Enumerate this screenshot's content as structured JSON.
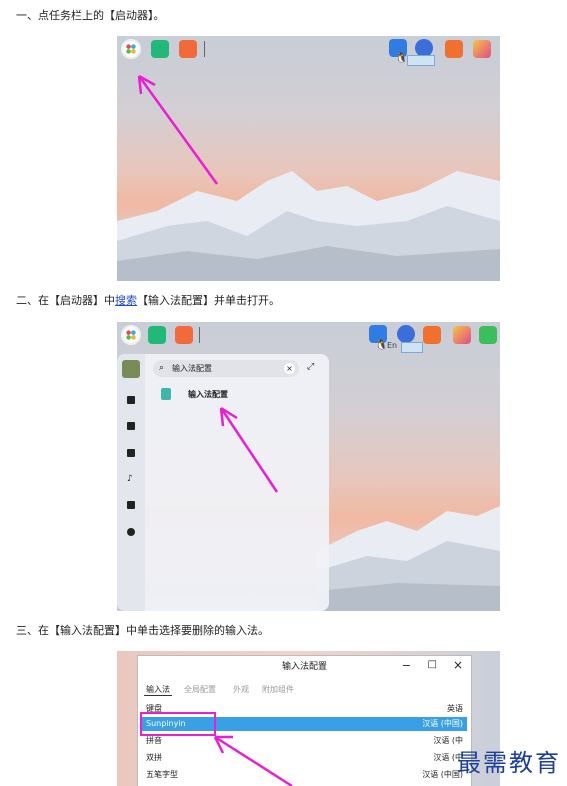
{
  "steps": {
    "s1": "一、点任务栏上的【启动器】。",
    "s2_prefix": "二、在【启动器】中",
    "s2_link": "搜索",
    "s2_suffix": "【输入法配置】并单击打开。",
    "s3": "三、在【输入法配置】中单击选择要删除的输入法。"
  },
  "tray": {
    "keyboard_indicator": "En"
  },
  "launcher_popup": {
    "search_value": "输入法配置",
    "result_label": "输入法配置"
  },
  "im_config_window": {
    "title": "输入法配置",
    "controls": [
      "−",
      "□",
      "×"
    ],
    "tabs": [
      "输入法",
      "全局配置",
      "外观",
      "附加组件"
    ],
    "rows": [
      {
        "name": "键盘",
        "lang": "英语"
      },
      {
        "name": "Sunpinyin",
        "lang": "汉语 (中国)"
      },
      {
        "name": "拼音",
        "lang": "汉语 (中"
      },
      {
        "name": "双拼",
        "lang": "汉语 (中"
      },
      {
        "name": "五笔字型",
        "lang": "汉语 (中国)"
      }
    ],
    "selected_row": 1
  },
  "watermark": "最需教育",
  "colors": {
    "accent_arrow": "#e81fd4",
    "selection": "#3aa0e6",
    "link": "#1a49c9"
  }
}
